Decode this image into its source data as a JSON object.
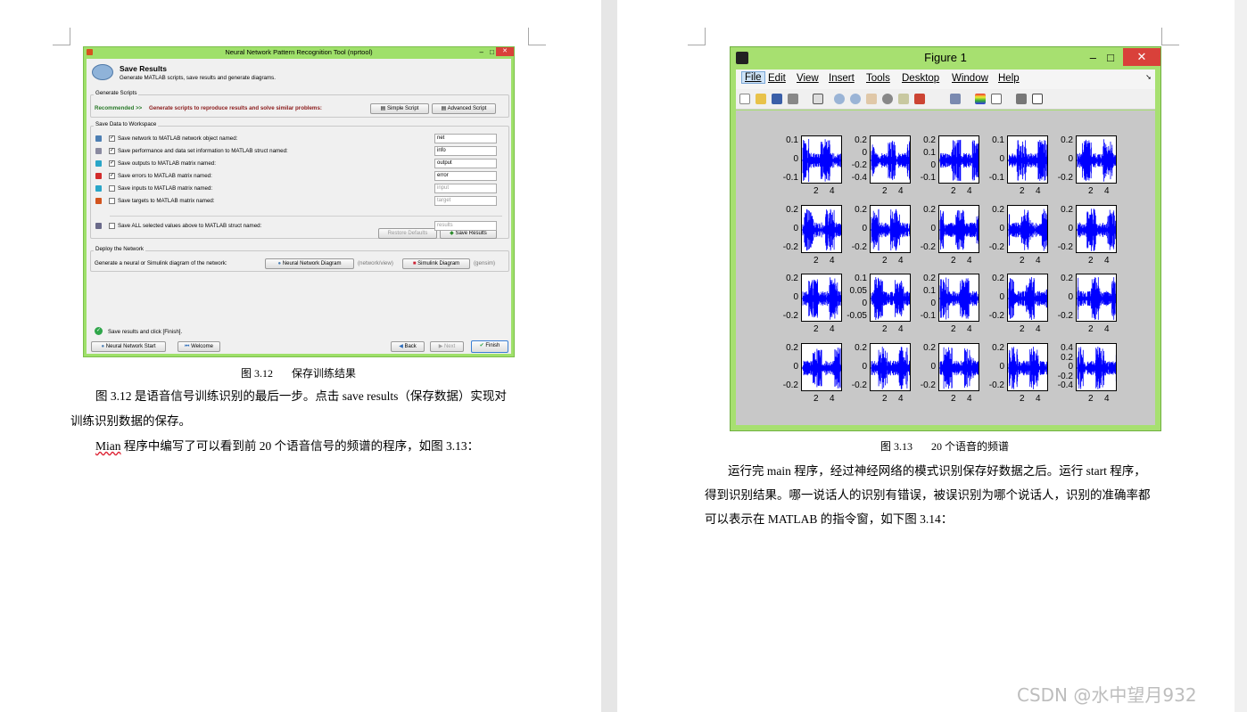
{
  "nn_tool": {
    "title": "Neural Network Pattern Recognition Tool (nprtool)",
    "heading": "Save Results",
    "subheading": "Generate MATLAB scripts, save results and generate diagrams.",
    "generate_scripts_label": "Generate Scripts",
    "recommended": "Recommended >>",
    "recommended_text": "Generate scripts to reproduce results and solve similar problems:",
    "simple_script": "Simple Script",
    "advanced_script": "Advanced Script",
    "save_data_label": "Save Data to Workspace",
    "rows": [
      {
        "label": "Save network to MATLAB network object named:",
        "value": "net",
        "checked": true,
        "icon": "#4d7fb3"
      },
      {
        "label": "Save performance and data set information to MATLAB struct named:",
        "value": "info",
        "checked": true,
        "icon": "#8a8aa0"
      },
      {
        "label": "Save outputs to MATLAB matrix named:",
        "value": "output",
        "checked": true,
        "icon": "#2aa6c8"
      },
      {
        "label": "Save errors to MATLAB matrix named:",
        "value": "error",
        "checked": true,
        "icon": "#d22c2c"
      },
      {
        "label": "Save inputs to MATLAB matrix named:",
        "value": "input",
        "checked": false,
        "icon": "#2aa6c8"
      },
      {
        "label": "Save targets to MATLAB matrix named:",
        "value": "target",
        "checked": false,
        "icon": "#d2541e"
      },
      {
        "label": "Save ALL selected values above to MATLAB struct named:",
        "value": "results",
        "checked": false,
        "icon": "#6a6a8a"
      }
    ],
    "restore_defaults": "Restore Defaults",
    "save_results": "Save Results",
    "deploy_label": "Deploy the Network",
    "deploy_text": "Generate a neural or Simulink diagram of the network:",
    "nn_diagram": "Neural Network Diagram",
    "nn_diagram_note": "(network/view)",
    "simulink_diagram": "Simulink Diagram",
    "simulink_note": "(gensim)",
    "status": "Save results and click [Finish].",
    "nn_start": "Neural Network Start",
    "welcome": "Welcome",
    "back": "Back",
    "next": "Next",
    "finish": "Finish"
  },
  "left_page": {
    "caption_num": "图 3.12",
    "caption_text": "保存训练结果",
    "para1_line1": "图 3.12 是语音信号训练识别的最后一步。点击 save results（保存数据）实现对",
    "para1_line2": "训练识别数据的保存。",
    "para2_mian": "Mian",
    "para2_rest": " 程序中编写了可以看到前 20 个语音信号的频谱的程序，如图 3.13："
  },
  "figure": {
    "title": "Figure 1",
    "menu": [
      "File",
      "Edit",
      "View",
      "Insert",
      "Tools",
      "Desktop",
      "Window",
      "Help"
    ],
    "x_ticks": [
      "2",
      "4"
    ],
    "plots": [
      {
        "yticks": [
          "0.1",
          "0",
          "-0.1"
        ],
        "seed": 1
      },
      {
        "yticks": [
          "0.2",
          "0",
          "-0.2",
          "-0.4"
        ],
        "seed": 2
      },
      {
        "yticks": [
          "0.2",
          "0.1",
          "0",
          "-0.1"
        ],
        "seed": 3
      },
      {
        "yticks": [
          "0.1",
          "0",
          "-0.1"
        ],
        "seed": 4
      },
      {
        "yticks": [
          "0.2",
          "0",
          "-0.2"
        ],
        "seed": 5
      },
      {
        "yticks": [
          "0.2",
          "0",
          "-0.2"
        ],
        "seed": 6
      },
      {
        "yticks": [
          "0.2",
          "0",
          "-0.2"
        ],
        "seed": 7
      },
      {
        "yticks": [
          "0.2",
          "0",
          "-0.2"
        ],
        "seed": 8
      },
      {
        "yticks": [
          "0.2",
          "0",
          "-0.2"
        ],
        "seed": 9
      },
      {
        "yticks": [
          "0.2",
          "0",
          "-0.2"
        ],
        "seed": 10
      },
      {
        "yticks": [
          "0.2",
          "0",
          "-0.2"
        ],
        "seed": 11
      },
      {
        "yticks": [
          "0.1",
          "0.05",
          "0",
          "-0.05"
        ],
        "seed": 12
      },
      {
        "yticks": [
          "0.2",
          "0.1",
          "0",
          "-0.1"
        ],
        "seed": 13
      },
      {
        "yticks": [
          "0.2",
          "0",
          "-0.2"
        ],
        "seed": 14
      },
      {
        "yticks": [
          "0.2",
          "0",
          "-0.2"
        ],
        "seed": 15
      },
      {
        "yticks": [
          "0.2",
          "0",
          "-0.2"
        ],
        "seed": 16
      },
      {
        "yticks": [
          "0.2",
          "0",
          "-0.2"
        ],
        "seed": 17
      },
      {
        "yticks": [
          "0.2",
          "0",
          "-0.2"
        ],
        "seed": 18
      },
      {
        "yticks": [
          "0.2",
          "0",
          "-0.2"
        ],
        "seed": 19
      },
      {
        "yticks": [
          "0.4",
          "0.2",
          "0",
          "-0.2",
          "-0.4"
        ],
        "seed": 20
      }
    ]
  },
  "right_page": {
    "caption_num": "图 3.13",
    "caption_text": "20 个语音的频谱",
    "line1": "运行完 main 程序，经过神经网络的模式识别保存好数据之后。运行 start 程序，",
    "line2": "得到识别结果。哪一说话人的识别有错误，被误识别为哪个说话人，识别的准确率都",
    "line3": "可以表示在 MATLAB 的指令窗，如下图 3.14："
  },
  "watermark": "CSDN @水中望月932"
}
